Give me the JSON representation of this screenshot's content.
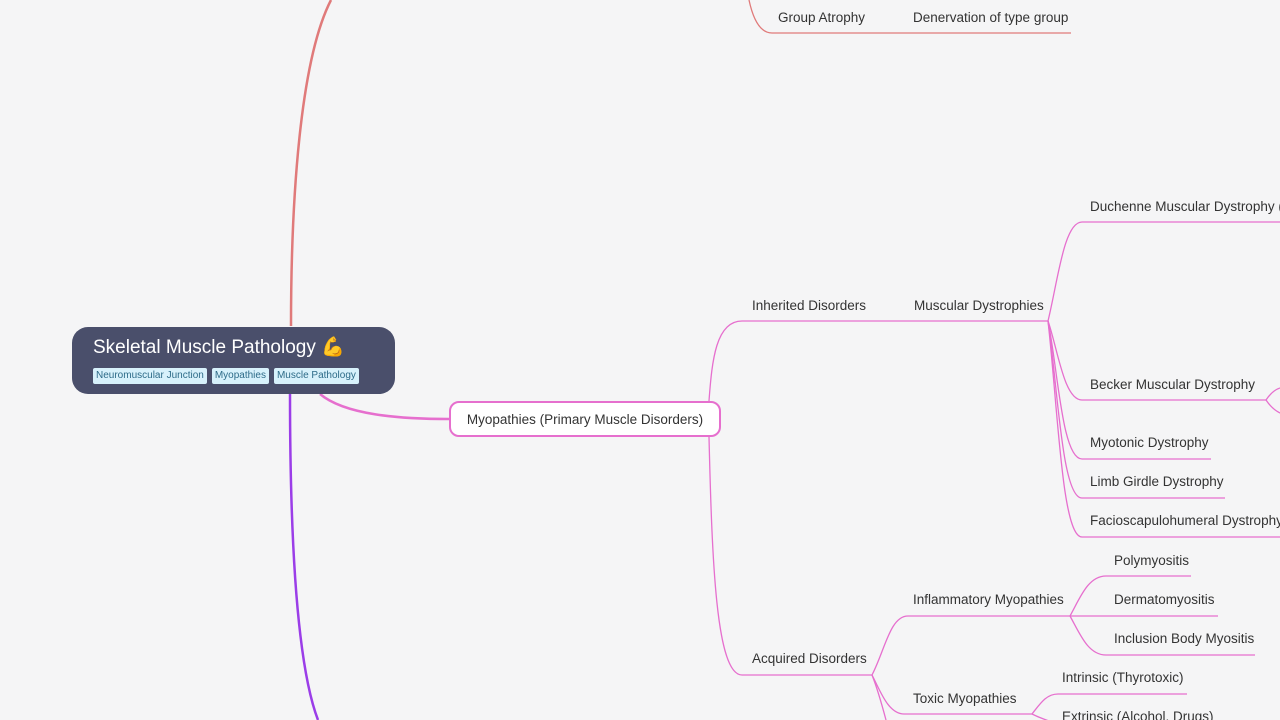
{
  "root": {
    "title": "Skeletal Muscle Pathology 💪",
    "tags": [
      "Neuromuscular Junction",
      "Myopathies",
      "Muscle Pathology"
    ]
  },
  "top_branch": {
    "group_atrophy": "Group Atrophy",
    "denervation": "Denervation of type group"
  },
  "myopathies": {
    "label": "Myopathies (Primary Muscle Disorders)",
    "inherited": {
      "label": "Inherited Disorders",
      "muscular_dystrophies": {
        "label": "Muscular Dystrophies",
        "items": [
          "Duchenne Muscular Dystrophy (",
          "Becker Muscular Dystrophy",
          "Myotonic Dystrophy",
          "Limb Girdle Dystrophy",
          "Facioscapulohumeral Dystrophy"
        ]
      }
    },
    "acquired": {
      "label": "Acquired Disorders",
      "inflammatory": {
        "label": "Inflammatory Myopathies",
        "items": [
          "Polymyositis",
          "Dermatomyositis",
          "Inclusion Body Myositis"
        ]
      },
      "toxic": {
        "label": "Toxic Myopathies",
        "items": [
          "Intrinsic (Thyrotoxic)",
          "Extrinsic (Alcohol, Drugs)"
        ]
      }
    }
  },
  "colors": {
    "background": "#f5f5f6",
    "root_fill": "#4a4f6b",
    "branch_red": "#e07a7a",
    "branch_pink": "#e66fce",
    "branch_purple": "#9b3de8"
  }
}
